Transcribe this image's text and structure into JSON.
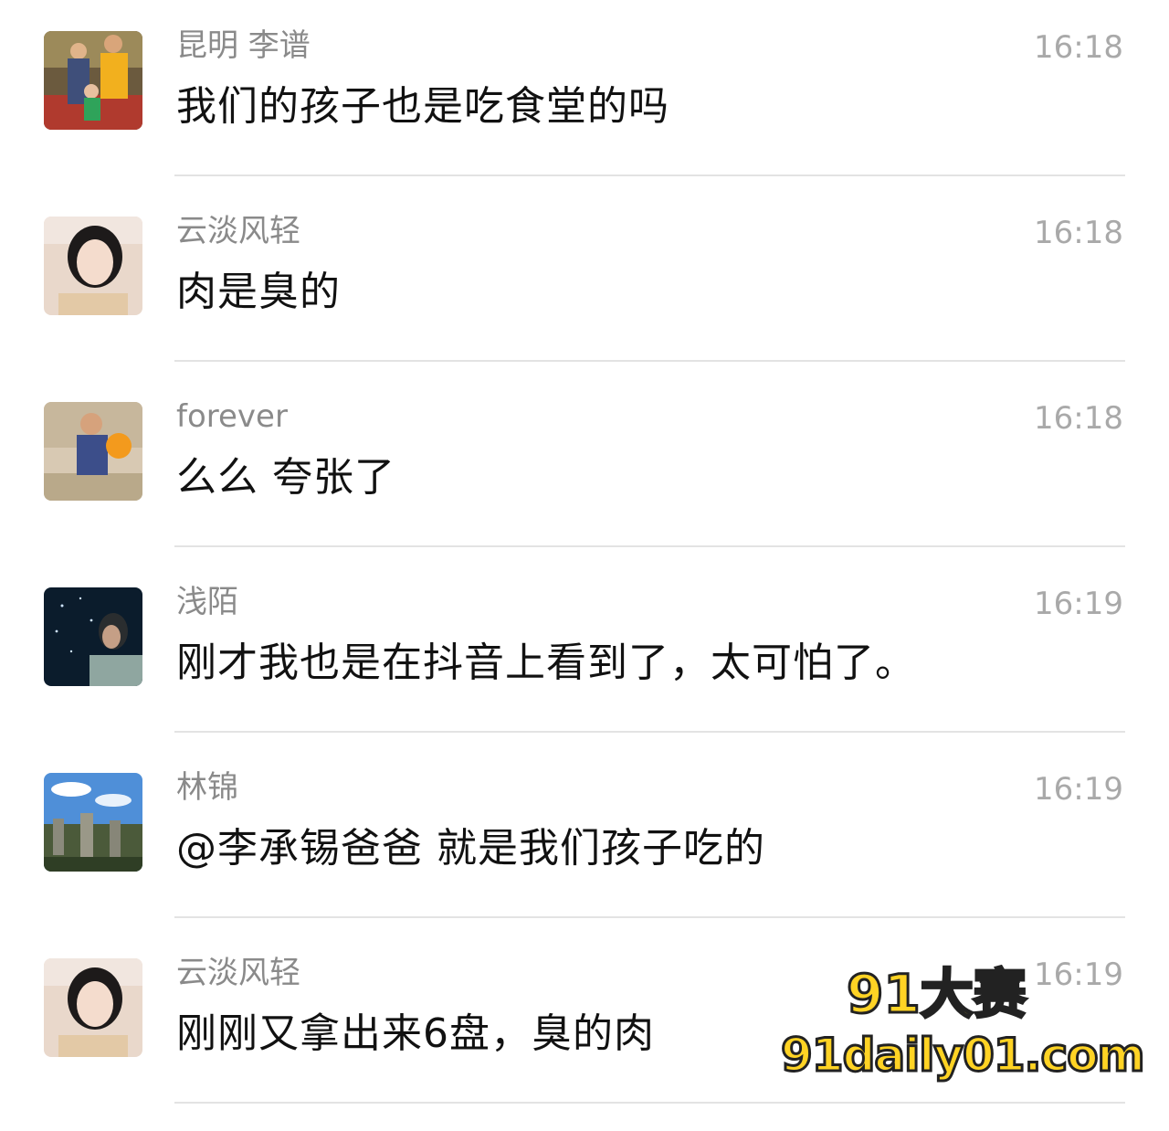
{
  "messages": [
    {
      "name": "昆明 李谱",
      "time": "16:18",
      "text": "我们的孩子也是吃食堂的吗",
      "avatar": "family-photo-avatar"
    },
    {
      "name": "云淡风轻",
      "time": "16:18",
      "text": "肉是臭的",
      "avatar": "woman-portrait-avatar"
    },
    {
      "name": "forever",
      "time": "16:18",
      "text": "么么  夸张了",
      "avatar": "child-balloon-avatar"
    },
    {
      "name": "浅陌",
      "time": "16:19",
      "text": "刚才我也是在抖音上看到了，太可怕了。",
      "avatar": "night-sky-avatar"
    },
    {
      "name": "林锦",
      "time": "16:19",
      "text": "@李承锡爸爸 就是我们孩子吃的",
      "avatar": "landscape-avatar"
    },
    {
      "name": "云淡风轻",
      "time": "16:19",
      "text": "刚刚又拿出来6盘，臭的肉",
      "avatar": "woman-portrait-avatar"
    }
  ],
  "watermark": {
    "line1": "91大赛",
    "line2": "91daily01.com"
  },
  "colors": {
    "name": "#8a8a8a",
    "time": "#a9a9a9",
    "text": "#111111",
    "divider": "#e3e3e3",
    "watermark": "#ffd324"
  }
}
